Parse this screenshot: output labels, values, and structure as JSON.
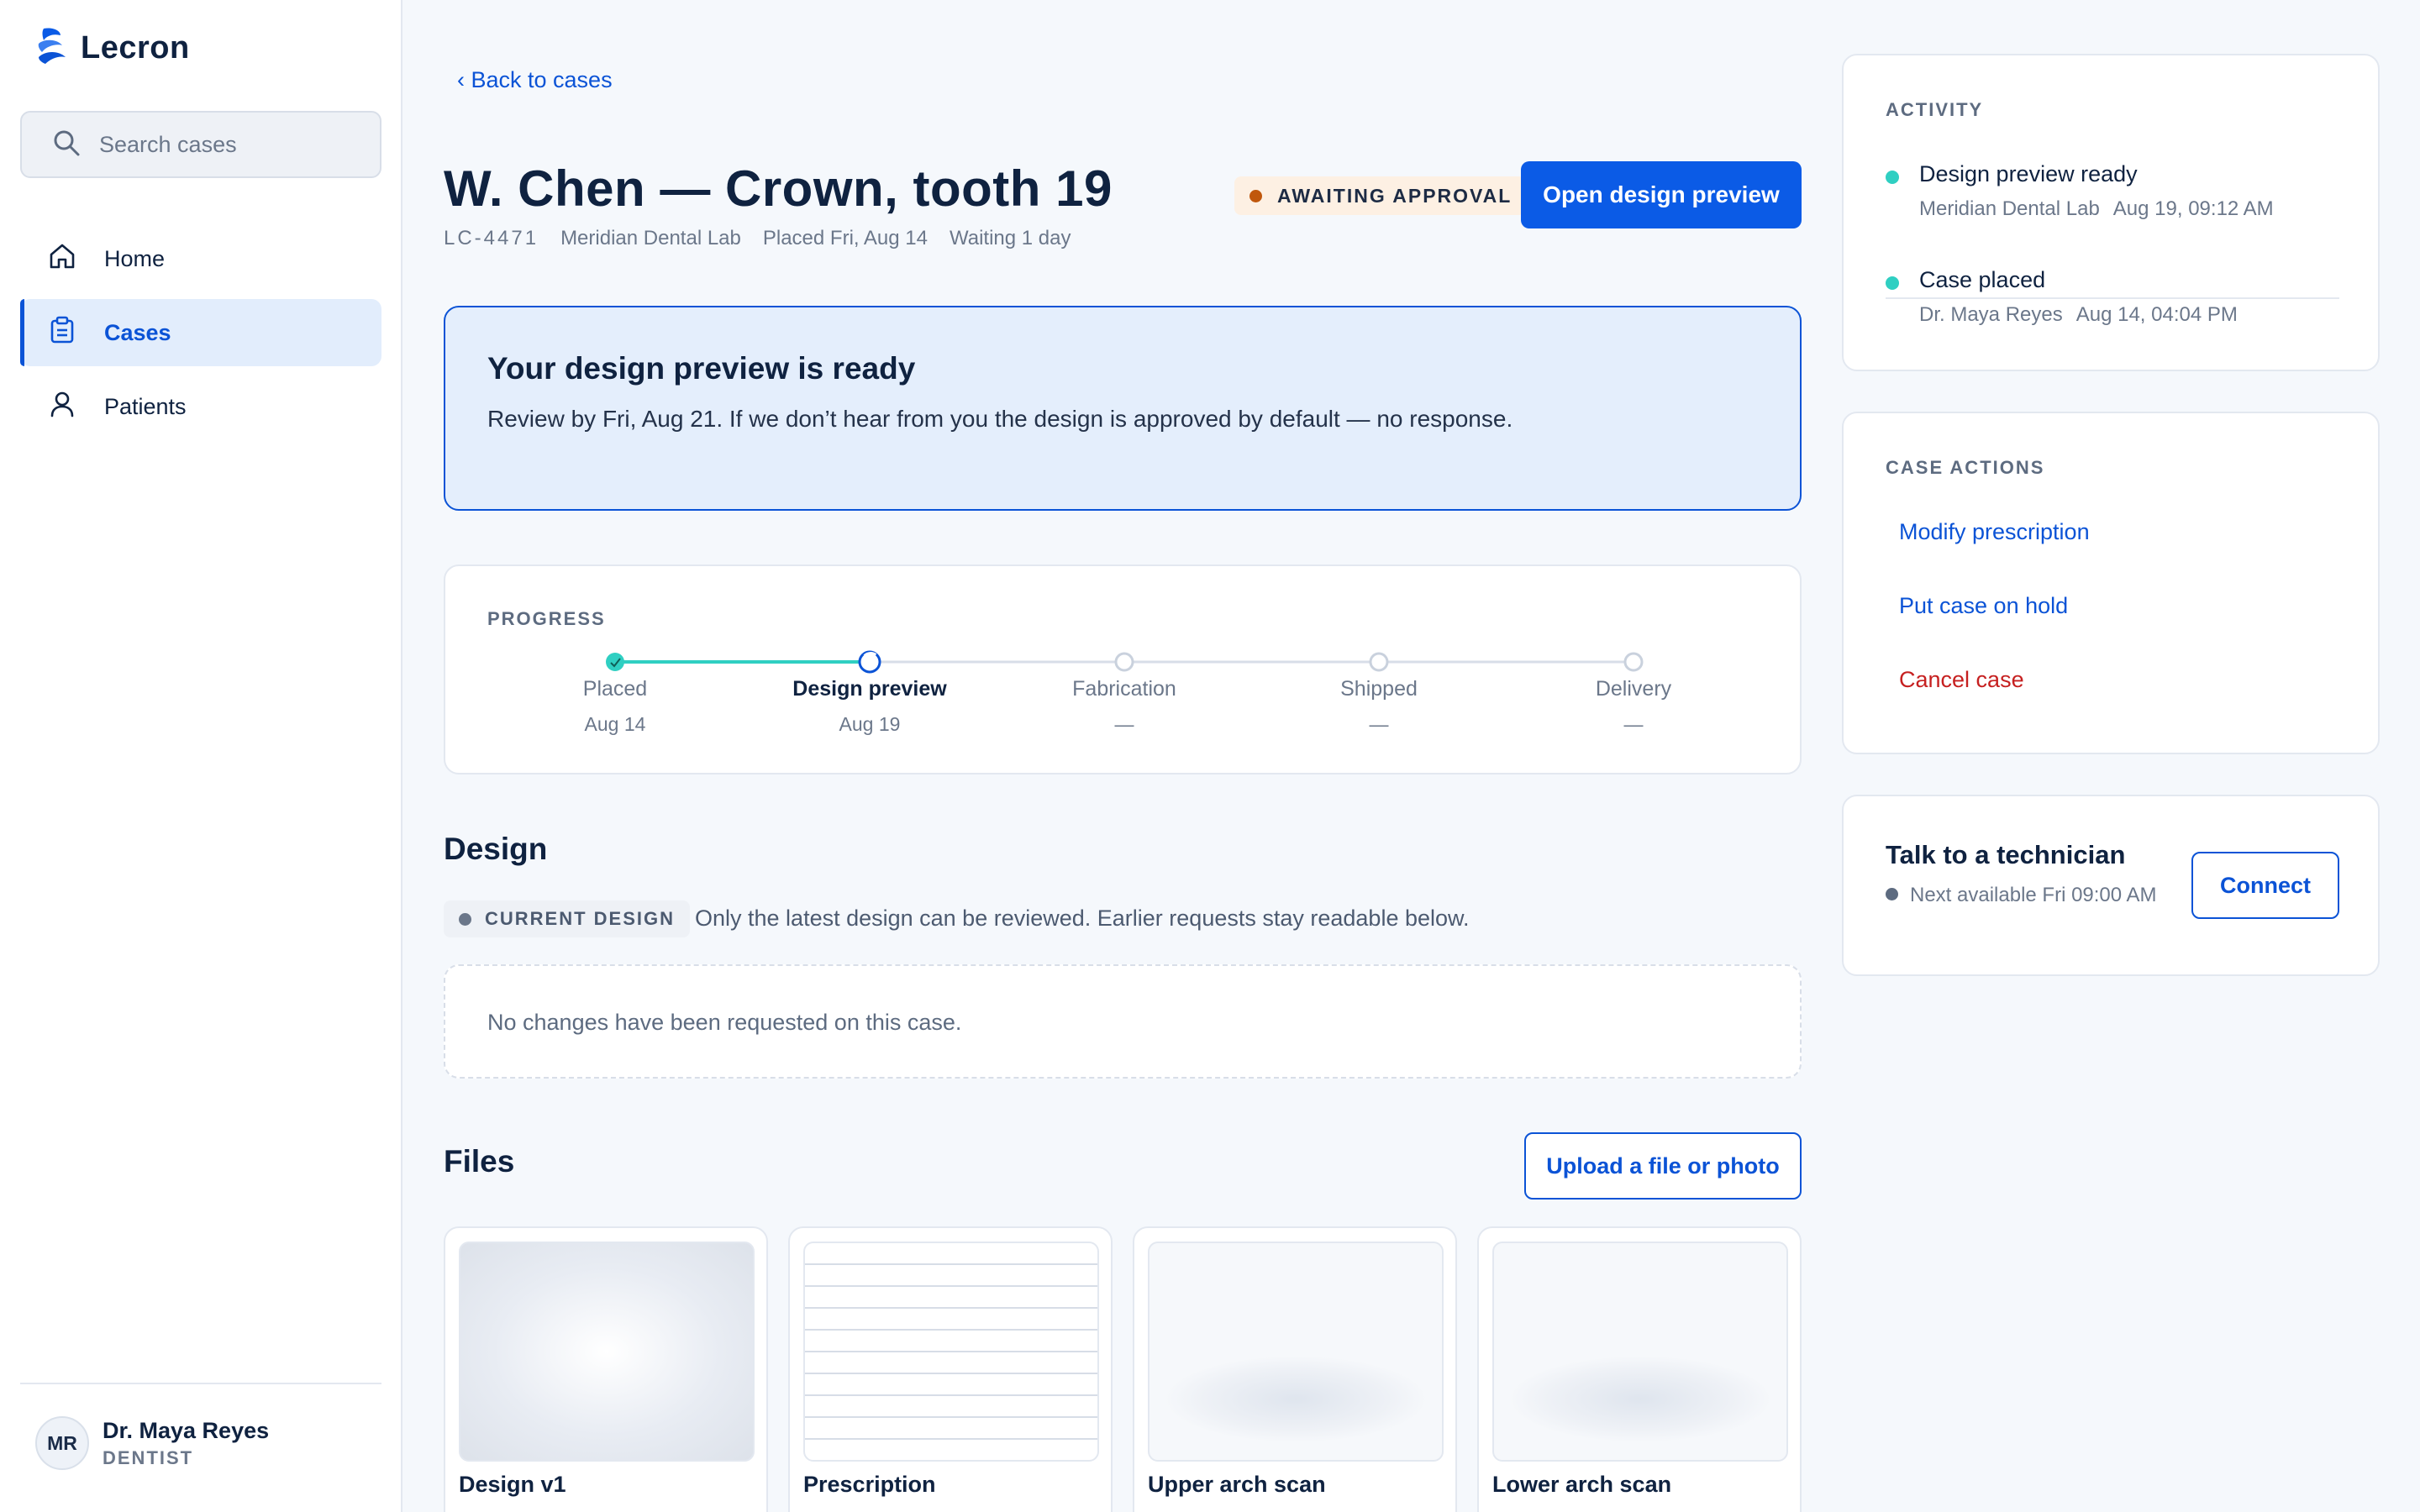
{
  "app": {
    "name": "Lecron"
  },
  "sidebar": {
    "search_placeholder": "Search cases",
    "nav": [
      {
        "label": "Home",
        "icon": "home-icon",
        "active": false
      },
      {
        "label": "Cases",
        "icon": "clipboard-icon",
        "active": true
      },
      {
        "label": "Patients",
        "icon": "person-icon",
        "active": false
      }
    ],
    "user": {
      "initials": "MR",
      "name": "Dr. Maya Reyes",
      "role": "DENTIST"
    }
  },
  "header": {
    "back_label": "‹ Back to cases",
    "title": "W. Chen — Crown, tooth 19",
    "meta": {
      "case_id": "LC-4471",
      "lab": "Meridian Dental Lab",
      "placed": "Placed Fri, Aug 14",
      "waiting": "Waiting 1 day"
    },
    "status": "AWAITING APPROVAL",
    "primary_action": "Open design preview"
  },
  "notice": {
    "title": "Your design preview is ready",
    "body": "Review by Fri, Aug 21. If we don’t hear from you the design is approved by default — no response."
  },
  "progress": {
    "label": "PROGRESS",
    "steps": [
      {
        "name": "Placed",
        "date": "Aug 14",
        "state": "done"
      },
      {
        "name": "Design preview",
        "date": "Aug 19",
        "state": "current"
      },
      {
        "name": "Fabrication",
        "date": "—",
        "state": "pending"
      },
      {
        "name": "Shipped",
        "date": "—",
        "state": "pending"
      },
      {
        "name": "Delivery",
        "date": "—",
        "state": "pending"
      }
    ]
  },
  "design": {
    "heading": "Design",
    "chip": "CURRENT DESIGN",
    "note": "Only the latest design can be reviewed. Earlier requests stay readable below.",
    "empty": "No changes have been requested on this case."
  },
  "files": {
    "heading": "Files",
    "upload_label": "Upload a file or photo",
    "items": [
      {
        "name": "Design v1"
      },
      {
        "name": "Prescription"
      },
      {
        "name": "Upper arch scan"
      },
      {
        "name": "Lower arch scan"
      }
    ]
  },
  "activity": {
    "label": "ACTIVITY",
    "items": [
      {
        "title": "Design preview ready",
        "who": "Meridian Dental Lab",
        "when": "Aug 19, 09:12 AM"
      },
      {
        "title": "Case placed",
        "who": "Dr. Maya Reyes",
        "when": "Aug 14, 04:04 PM"
      }
    ]
  },
  "case_actions": {
    "label": "CASE ACTIONS",
    "items": [
      {
        "label": "Modify prescription"
      },
      {
        "label": "Put case on hold"
      },
      {
        "label": "Cancel case"
      }
    ]
  },
  "technician": {
    "title": "Talk to a technician",
    "availability": "Next available Fri 09:00 AM",
    "connect_label": "Connect"
  },
  "colors": {
    "accent": "#0b53d6",
    "teal": "#2fcfc2",
    "danger": "#c62020",
    "warning_dot": "#c0570c"
  }
}
